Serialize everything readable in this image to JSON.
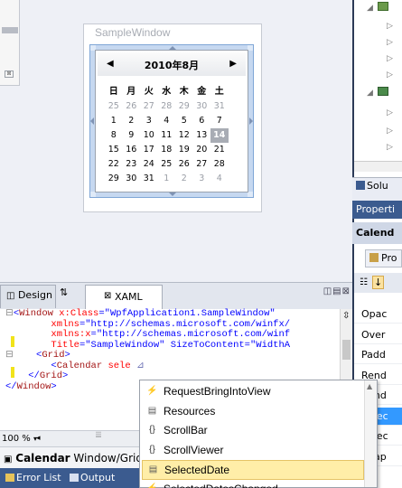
{
  "designer": {
    "window_title": "SampleWindow",
    "calendar": {
      "month_label": "2010年8月",
      "prev_arrow": "◀",
      "next_arrow": "▶",
      "weekdays": [
        "日",
        "月",
        "火",
        "水",
        "木",
        "金",
        "土"
      ],
      "weeks": [
        [
          "25",
          "26",
          "27",
          "28",
          "29",
          "30",
          "31"
        ],
        [
          "1",
          "2",
          "3",
          "4",
          "5",
          "6",
          "7"
        ],
        [
          "8",
          "9",
          "10",
          "11",
          "12",
          "13",
          "14"
        ],
        [
          "15",
          "16",
          "17",
          "18",
          "19",
          "20",
          "21"
        ],
        [
          "22",
          "23",
          "24",
          "25",
          "26",
          "27",
          "28"
        ],
        [
          "29",
          "30",
          "31",
          "1",
          "2",
          "3",
          "4"
        ]
      ],
      "today": "14"
    }
  },
  "solution_panel": {
    "tab_label": "Solu",
    "tree_arrows": [
      "◢",
      "▷",
      "▷",
      "▷",
      "▷",
      "◢",
      "▷",
      "▷",
      "▷"
    ]
  },
  "properties": {
    "header": "Properti",
    "title": "Calend",
    "tab": "Pro",
    "rows": [
      "Opac",
      "Over",
      "Padd",
      "Rend",
      "Rend",
      "Selec",
      "Selec",
      "Snap"
    ]
  },
  "view_tabs": {
    "design": "Design",
    "swap": "⇅",
    "xaml": "XAML",
    "split_icons": "◫▤⊠"
  },
  "editor": {
    "lines": [
      {
        "fold": "⊟",
        "pre": "<",
        "tag": "Window",
        "attr": " x:Class",
        "eq": "=",
        "val": "\"WpfApplication1.SampleWindow\""
      },
      {
        "fold": "",
        "pre": "        ",
        "tag": "",
        "attr": "xmlns",
        "eq": "=",
        "val": "\"http://schemas.microsoft.com/winfx/"
      },
      {
        "fold": "",
        "pre": "        ",
        "tag": "",
        "attr": "xmlns:x",
        "eq": "=",
        "val": "\"http://schemas.microsoft.com/winf"
      },
      {
        "fold": "",
        "pre": "        ",
        "tag": "",
        "attr": "Title",
        "eq": "=",
        "val": "\"SampleWindow\" SizeToContent=\"WidthA"
      },
      {
        "fold": "⊟",
        "pre": "    <",
        "tag": "Grid",
        "attr": "",
        "eq": "",
        "val": ">"
      },
      {
        "fold": "",
        "pre": "        <",
        "tag": "Calendar",
        "attr": " sele",
        "eq": "",
        "val": ""
      },
      {
        "fold": "",
        "pre": "    </",
        "tag": "Grid",
        "attr": "",
        "eq": "",
        "val": ">"
      },
      {
        "fold": "",
        "pre": "</",
        "tag": "Window",
        "attr": "",
        "eq": "",
        "val": ">"
      }
    ],
    "zoom": "100 %",
    "breadcrumb_element": "Calendar",
    "breadcrumb_path": "Window/Grid"
  },
  "bottom_tabs": {
    "error_list": "Error List",
    "output": "Output"
  },
  "intellisense": {
    "items": [
      {
        "label": "RequestBringIntoView",
        "icon": "event-icon"
      },
      {
        "label": "Resources",
        "icon": "property-icon"
      },
      {
        "label": "ScrollBar",
        "icon": "namespace-icon"
      },
      {
        "label": "ScrollViewer",
        "icon": "namespace-icon"
      },
      {
        "label": "SelectedDate",
        "icon": "property-icon"
      },
      {
        "label": "SelectedDatesChanged",
        "icon": "event-icon"
      }
    ],
    "selected_index": 4
  }
}
